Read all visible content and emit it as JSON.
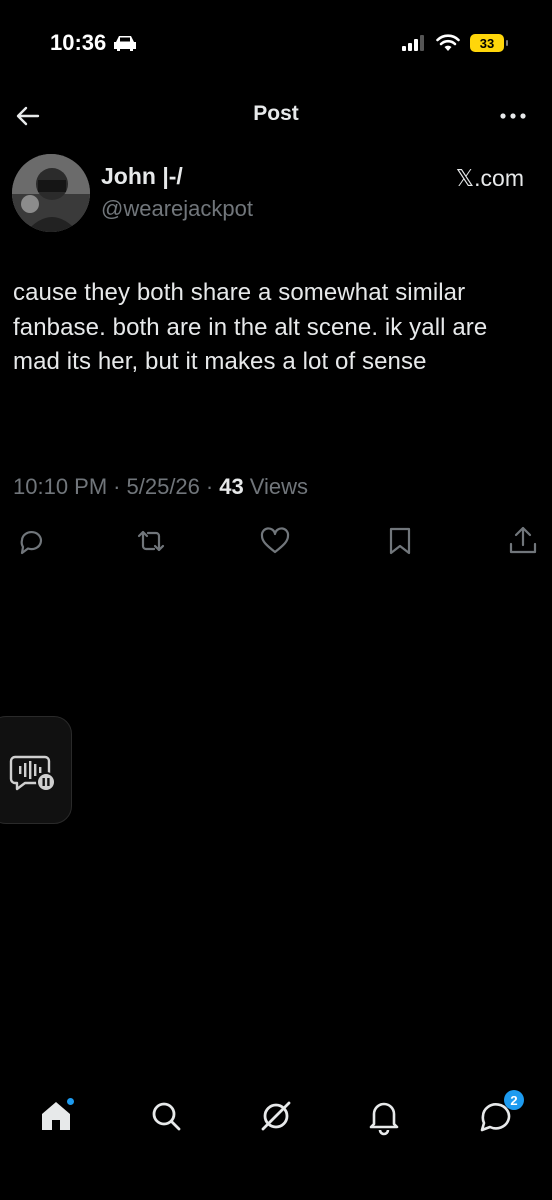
{
  "status_bar": {
    "time": "10:36",
    "battery": "33",
    "icons": [
      "car-icon",
      "cellular-signal-icon",
      "wifi-icon",
      "battery-icon"
    ]
  },
  "header": {
    "title": "Post",
    "back_icon": "arrow-left-icon",
    "more_icon": "more-icon"
  },
  "author": {
    "name": "John |-/",
    "handle": "@wearejackpot",
    "source": "𝕏.com"
  },
  "tweet": {
    "text": "cause they both share a somewhat similar fanbase. both are in the alt scene. ik yall are mad its her, but it makes a lot of sense",
    "time": "10:10 PM",
    "date": "5/25/26",
    "views_count": "43",
    "views_label": "Views",
    "separator": "·"
  },
  "actions": [
    "reply-icon",
    "repost-icon",
    "like-icon",
    "bookmark-icon",
    "share-icon"
  ],
  "bottom_nav": {
    "items": [
      "home-icon",
      "search-icon",
      "grok-icon",
      "notifications-icon",
      "messages-icon"
    ],
    "messages_badge": "2",
    "accent_color": "#1d9bf0"
  }
}
